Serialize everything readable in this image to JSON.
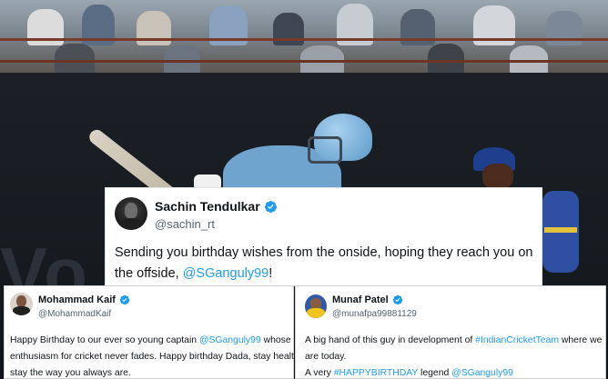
{
  "colors": {
    "link": "#1d9bf0",
    "verified_badge": "#1d9bf0",
    "text_primary": "#0f1419",
    "text_secondary": "#536471",
    "card_background": "#ffffff"
  },
  "background_photo": {
    "subject": "batsman-playing-shot-with-wicketkeeper",
    "wall_text": "Vo"
  },
  "main_tweet": {
    "avatar_icon": "profile-avatar",
    "display_name": "Sachin Tendulkar",
    "verified_icon": "verified-badge-icon",
    "handle": "@sachin_rt",
    "line1": "Sending you birthday wishes from the onside, hoping they reach you on",
    "line2_text": "the offside, ",
    "line2_mention": "@SGanguly99",
    "line2_end": "!"
  },
  "left_tweet": {
    "avatar_icon": "profile-avatar",
    "display_name": "Mohammad Kaif",
    "verified_icon": "verified-badge-icon",
    "handle": "@MohammadKaif",
    "line1_text": "Happy Birthday to our ever so young captain ",
    "line1_mention": "@SGanguly99",
    "line1_end": " whose",
    "line2": "enthusiasm for cricket never fades. Happy birthday Dada, stay healthy,",
    "line3": "stay the way you always are."
  },
  "right_tweet": {
    "avatar_icon": "profile-avatar",
    "display_name": "Munaf Patel",
    "verified_icon": "verified-badge-icon",
    "handle": "@munafpa99881129",
    "line1_text": "A big hand of this guy in development of ",
    "line1_hashtag": "#IndianCricketTeam",
    "line1_end": " where we",
    "line2": "are today.",
    "line3_text": "A very ",
    "line3_hashtag": "#HAPPYBIRTHDAY",
    "line3_mid": " legend ",
    "line3_mention": "@SGanguly99"
  }
}
